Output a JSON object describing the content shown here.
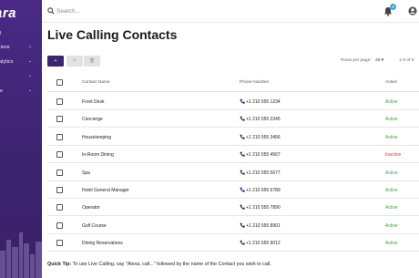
{
  "sidebar": {
    "brand": "ara",
    "items": [
      {
        "label": "rd",
        "has_submenu": false
      },
      {
        "label": "ations",
        "has_submenu": true
      },
      {
        "label": "nalytics",
        "has_submenu": true
      },
      {
        "label": "s",
        "has_submenu": true
      },
      {
        "label": "ice",
        "has_submenu": true
      }
    ]
  },
  "header": {
    "search_placeholder": "Search...",
    "notification_count": "6"
  },
  "page": {
    "title": "Live Calling Contacts"
  },
  "toolbar": {
    "add_label": "+",
    "edit_label": "✎",
    "delete_label": "🗑",
    "rows_per_page_label": "Rows per page:",
    "rows_per_page_value": "20 ▾",
    "pagination": "1-9 of 9"
  },
  "table": {
    "headers": {
      "name": "Contact Name",
      "phone": "Phone Number",
      "status": "Active"
    },
    "rows": [
      {
        "name": "Front Desk",
        "phone": "+1 210 555 1234",
        "status": "Active"
      },
      {
        "name": "Concierge",
        "phone": "+1 210 555 2345",
        "status": "Active"
      },
      {
        "name": "Housekeeping",
        "phone": "+1 210 555 3456",
        "status": "Active"
      },
      {
        "name": "In-Room Dining",
        "phone": "+1 210 555 4567",
        "status": "Inactive"
      },
      {
        "name": "Spa",
        "phone": "+1 210 555 5677",
        "status": "Active"
      },
      {
        "name": "Hotel General Manager",
        "phone": "+1 210 555 6789",
        "status": "Active"
      },
      {
        "name": "Operator",
        "phone": "+1 210 555 7890",
        "status": "Active"
      },
      {
        "name": "Golf Course",
        "phone": "+1 210 555 8901",
        "status": "Active"
      },
      {
        "name": "Dining Reservations",
        "phone": "+1 210 555 9012",
        "status": "Active"
      }
    ]
  },
  "footer": {
    "tip_label": "Quick Tip:",
    "tip_text": " To use Live Calling, say \"Alexa, call...\" followed by the name of the Contact you wish to call."
  },
  "colors": {
    "brand": "#3d2470",
    "active": "#3aa53a",
    "inactive": "#e0342c",
    "phone_icon": "#3d2470",
    "badge": "#3ba4dc"
  }
}
